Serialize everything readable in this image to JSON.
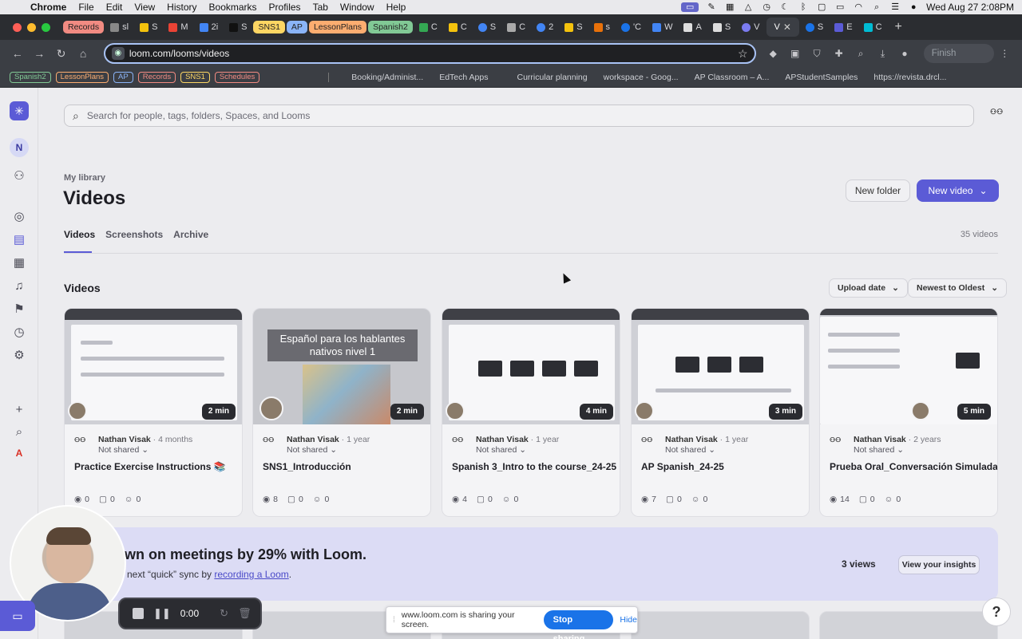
{
  "menubar": {
    "app": "Chrome",
    "items": [
      "File",
      "Edit",
      "View",
      "History",
      "Bookmarks",
      "Profiles",
      "Tab",
      "Window",
      "Help"
    ],
    "datetime": "Wed Aug 27  2:08PM"
  },
  "tabs": {
    "group_records": "Records",
    "group_sns1": "SNS1",
    "group_ap": "AP",
    "group_lessonplans": "LessonPlans",
    "group_spanish2": "Spanish2",
    "tab_sl": "sl",
    "tab_s1": "S",
    "tab_m": "M",
    "tab_2i": "2i",
    "tab_s2": "S",
    "tab_c1": "C",
    "tab_c2": "C",
    "tab_s3": "S",
    "tab_c3": "C",
    "tab_2": "2",
    "tab_s4": "S",
    "tab_s5": "s",
    "tab_quote": "'C",
    "tab_w": "W",
    "tab_a": "A",
    "tab_s6": "S",
    "tab_v": "V",
    "active": "V",
    "tab_s7": "S",
    "tab_e": "E",
    "tab_c4": "C"
  },
  "toolbar": {
    "url": "loom.com/looms/videos",
    "finish_update": "Finish update"
  },
  "bookmarks": {
    "chips": [
      "Spanish2",
      "LessonPlans",
      "AP",
      "Records",
      "SNS1",
      "Schedules"
    ],
    "items": [
      "Booking/Administ...",
      "EdTech Apps",
      "Curricular planning",
      "workspace - Goog...",
      "AP Classroom – A...",
      "APStudentSamples",
      "https://revista.drcl..."
    ]
  },
  "rail": {
    "avatar_initial": "N",
    "text_a": "A"
  },
  "search": {
    "placeholder": "Search for people, tags, folders, Spaces, and Looms"
  },
  "header": {
    "breadcrumb": "My library",
    "title": "Videos",
    "new_folder": "New folder",
    "new_video": "New video"
  },
  "lib_tabs": [
    "Videos",
    "Screenshots",
    "Archive"
  ],
  "video_count": "35 videos",
  "section": {
    "title": "Videos",
    "sort_by": "Upload date",
    "sort_order": "Newest to Oldest"
  },
  "videos": [
    {
      "duration": "2 min",
      "author": "Nathan Visak",
      "age": " · 4 months",
      "sharing": "Not shared",
      "title": "Practice Exercise Instructions 📚",
      "views": "0",
      "comments": "0",
      "reactions": "0"
    },
    {
      "duration": "2 min",
      "author": "Nathan Visak",
      "age": " · 1 year",
      "sharing": "Not shared",
      "title": "SNS1_Introducción",
      "views": "8",
      "comments": "0",
      "reactions": "0",
      "thumb_text": "Español para los hablantes nativos nivel 1"
    },
    {
      "duration": "4 min",
      "author": "Nathan Visak",
      "age": " · 1 year",
      "sharing": "Not shared",
      "title": "Spanish 3_Intro to the course_24-25",
      "views": "4",
      "comments": "0",
      "reactions": "0"
    },
    {
      "duration": "3 min",
      "author": "Nathan Visak",
      "age": " · 1 year",
      "sharing": "Not shared",
      "title": "AP Spanish_24-25",
      "views": "7",
      "comments": "0",
      "reactions": "0"
    },
    {
      "duration": "5 min",
      "author": "Nathan Visak",
      "age": " · 2 years",
      "sharing": "Not shared",
      "title": "Prueba Oral_Conversación Simulada1",
      "views": "14",
      "comments": "0",
      "reactions": "0"
    }
  ],
  "promo": {
    "title": "own on meetings by 29% with Loom.",
    "sub_prefix": "ur next “quick” sync by ",
    "sub_link": "recording a Loom",
    "sub_suffix": ".",
    "views": "3 views",
    "insights_button": "View your insights"
  },
  "recorder": {
    "timer": "0:00"
  },
  "share_bar": {
    "message": "www.loom.com is sharing your screen.",
    "stop": "Stop sharing",
    "hide": "Hide"
  },
  "help": "?",
  "colors": {
    "accent": "#5b5bd6",
    "chrome_blue": "#1a73e8"
  }
}
